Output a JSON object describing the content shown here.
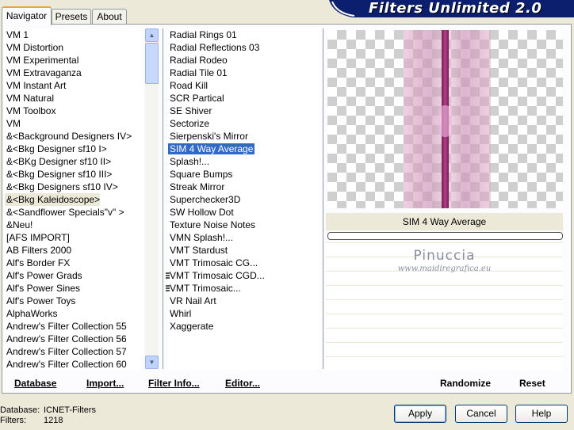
{
  "header": {
    "title": "Filters Unlimited 2.0"
  },
  "tabs": [
    {
      "label": "Navigator",
      "active": true
    },
    {
      "label": "Presets",
      "active": false
    },
    {
      "label": "About",
      "active": false
    }
  ],
  "categories": {
    "selected_index": 13,
    "items": [
      "VM 1",
      "VM Distortion",
      "VM Experimental",
      "VM Extravaganza",
      "VM Instant Art",
      "VM Natural",
      "VM Toolbox",
      "VM",
      "&<Background Designers IV>",
      "&<Bkg Designer sf10 I>",
      "&<BKg Designer sf10 II>",
      "&<Bkg Designer sf10 III>",
      "&<Bkg Designers sf10 IV>",
      "&<Bkg Kaleidoscope>",
      "&<Sandflower Specials\"v\" >",
      "&Neu!",
      "[AFS IMPORT]",
      "AB Filters 2000",
      "Alf's Border FX",
      "Alf's Power Grads",
      "Alf's Power Sines",
      "Alf's Power Toys",
      "AlphaWorks",
      "Andrew's Filter Collection 55",
      "Andrew's Filter Collection 56",
      "Andrew's Filter Collection 57",
      "Andrew's Filter Collection 60"
    ]
  },
  "filters": {
    "selected_index": 9,
    "items": [
      "Radial  Rings 01",
      "Radial Reflections 03",
      "Radial Rodeo",
      "Radial Tile 01",
      "Road Kill",
      "SCR  Partical",
      "SE Shiver",
      "Sectorize",
      "Sierpenski's Mirror",
      "SIM 4 Way Average",
      "Splash!...",
      "Square Bumps",
      "Streak Mirror",
      "Superchecker3D",
      "SW Hollow Dot",
      "Texture Noise Notes",
      "VMN Splash!...",
      "VMT Stardust",
      "VMT Trimosaic CG...",
      "VMT Trimosaic CGD...",
      "VMT Trimosaic...",
      "VR Nail Art",
      "Whirl",
      "Xaggerate"
    ]
  },
  "preview": {
    "filter_name": "SIM 4 Way Average",
    "progress": 0,
    "watermark_name": "Pinuccia",
    "watermark_url": "www.maidiregrafica.eu"
  },
  "toolbar": {
    "database_label": "Database",
    "import_label": "Import...",
    "filter_info_label": "Filter Info...",
    "editor_label": "Editor...",
    "randomize_label": "Randomize",
    "reset_label": "Reset"
  },
  "footer": {
    "database_label": "Database:",
    "database_value": "ICNET-Filters",
    "filters_label": "Filters:",
    "filters_value": "1218",
    "apply_label": "Apply",
    "cancel_label": "Cancel",
    "help_label": "Help"
  },
  "colors": {
    "selection": "#316ac5",
    "banner": "#0c1f6e",
    "accent_tab": "#f4a13a"
  }
}
